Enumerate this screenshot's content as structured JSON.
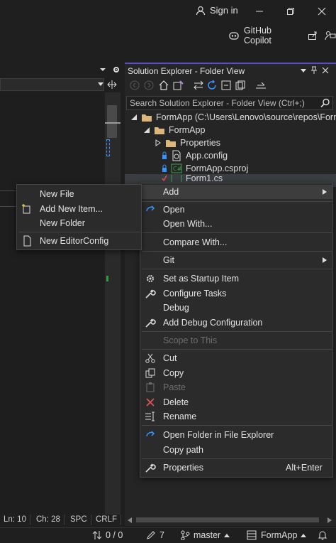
{
  "titlebar": {
    "signin_label": "Sign in",
    "copilot_label": "GitHub Copilot"
  },
  "solution_explorer": {
    "title": "Solution Explorer - Folder View",
    "search_placeholder": "Search Solution Explorer - Folder View (Ctrl+;)",
    "tree": [
      {
        "label": "FormApp (C:\\Users\\Lenovo\\source\\repos\\FormAp",
        "icon": "folder-icon"
      },
      {
        "label": "FormApp",
        "icon": "folder-icon"
      },
      {
        "label": "Properties",
        "icon": "folder-icon"
      },
      {
        "label": "App.config",
        "icon": "config-file-icon"
      },
      {
        "label": "FormApp.csproj",
        "icon": "csproj-icon"
      },
      {
        "label": "Form1.cs",
        "icon": "csharp-file-icon"
      }
    ]
  },
  "context_menu": {
    "items": [
      {
        "label": "Add",
        "icon": "",
        "submenu": true
      },
      {
        "label": "Open",
        "icon": "open-icon"
      },
      {
        "label": "Open With...",
        "icon": ""
      },
      {
        "label": "Compare With...",
        "icon": ""
      },
      {
        "label": "Git",
        "icon": "",
        "submenu": true
      },
      {
        "label": "Set as Startup Item",
        "icon": "gear-icon"
      },
      {
        "label": "Configure Tasks",
        "icon": "wrench-icon"
      },
      {
        "label": "Debug",
        "icon": ""
      },
      {
        "label": "Add Debug Configuration",
        "icon": "wrench-icon"
      },
      {
        "label": "Scope to This",
        "icon": "",
        "disabled": true
      },
      {
        "label": "Cut",
        "icon": "scissors-icon"
      },
      {
        "label": "Copy",
        "icon": "copy-icon"
      },
      {
        "label": "Paste",
        "icon": "paste-icon",
        "disabled": true
      },
      {
        "label": "Delete",
        "icon": "delete-icon"
      },
      {
        "label": "Rename",
        "icon": "rename-icon"
      },
      {
        "label": "Open Folder in File Explorer",
        "icon": "refresh-icon"
      },
      {
        "label": "Copy path",
        "icon": ""
      },
      {
        "label": "Properties",
        "icon": "wrench-icon",
        "shortcut": "Alt+Enter"
      }
    ]
  },
  "add_submenu": {
    "items": [
      {
        "label": "New File",
        "icon": ""
      },
      {
        "label": "Add New Item...",
        "icon": "new-item-icon"
      },
      {
        "label": "New Folder",
        "icon": ""
      },
      {
        "label": "New EditorConfig",
        "icon": "file-icon"
      }
    ]
  },
  "status": {
    "ln": "Ln: 10",
    "ch": "Ch: 28",
    "spc": "SPC",
    "crlf": "CRLF",
    "commits": "0 / 0",
    "changes": "7",
    "branch": "master",
    "repo": "FormApp"
  },
  "colors": {
    "accent": "#5b4fc6",
    "icon_blue": "#3794ff",
    "delete_red": "#e25555"
  }
}
